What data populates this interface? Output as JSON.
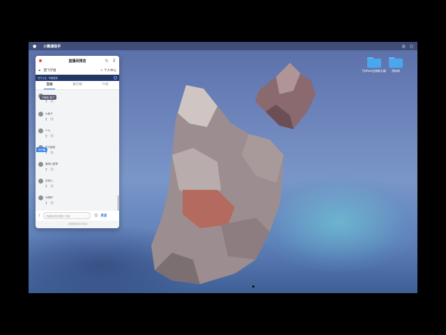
{
  "menubar": {
    "app_name": "小鹅通助手"
  },
  "desktop": {
    "icons": [
      {
        "label": "Python全栈新大纲"
      },
      {
        "label": "资料库"
      }
    ]
  },
  "panel": {
    "title": "直播间预览",
    "channel": "西飞学姐",
    "user_center": "个人中心",
    "banner": "官方认证 · 有趣直播",
    "tabs": [
      {
        "label": "互动"
      },
      {
        "label": "排行榜"
      },
      {
        "label": "介绍"
      }
    ],
    "messages": [
      {
        "name": "",
        "count": "7"
      },
      {
        "name": "大鱼子",
        "count": "7"
      },
      {
        "name": "十七",
        "count": "7"
      },
      {
        "name": "芒刃高俊",
        "count": "7"
      },
      {
        "name": "春明小童哥",
        "count": "7"
      },
      {
        "name": "空老心",
        "count": "7"
      },
      {
        "name": "冰馒伊",
        "count": "7"
      }
    ],
    "tooltip": "下雨天 有了",
    "live_tag": "去开播",
    "input": {
      "placeholder": "不能输出有效帮唱一句被",
      "send_label": "发送"
    },
    "footer": "小鹅通提供技术支持"
  }
}
